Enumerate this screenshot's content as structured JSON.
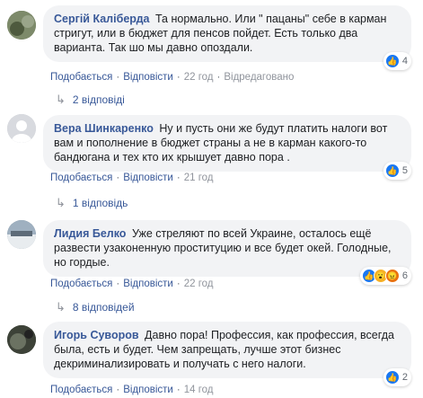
{
  "comments": [
    {
      "author": "Сергій Каліберда",
      "text": "Та нормально. Или \" пацаны\" себе в карман стригут, или в бюджет для пенсов пойдет. Есть только два варианта. Так шо мы давно опоздали.",
      "like_label": "Подобається",
      "reply_label": "Відповісти",
      "time": "22 год",
      "edited": "Відредаговано",
      "reaction_count": "4",
      "replies": "2 відповіді",
      "avatar_color": "#6d7a5a"
    },
    {
      "author": "Вера Шинкаренко",
      "text": "Ну и пусть они же будут платить налоги вот вам и пополнение в бюджет страны а не в карман какого-то бандюгана и тех кто их крышует давно пора .",
      "like_label": "Подобається",
      "reply_label": "Відповісти",
      "time": "21 год",
      "reaction_count": "5",
      "replies": "1 відповідь",
      "avatar_color": "#c8ccd1"
    },
    {
      "author": "Лидия Белко",
      "text": "Уже стреляют по всей Украине, осталось ещё развести узаконенную проституцию и все будет окей. Голодные, но гордые.",
      "like_label": "Подобається",
      "reply_label": "Відповісти",
      "time": "22 год",
      "reaction_count": "6",
      "replies": "8 відповідей",
      "avatar_color": "#8a9aa8"
    },
    {
      "author": "Игорь Суворов",
      "text": "Давно пора! Профессия, как профессия, всегда была, есть и будет. Чем запрещать, лучше этот бизнес декриминализировать и получать с него налоги.",
      "like_label": "Подобається",
      "reply_label": "Відповісти",
      "time": "14 год",
      "reaction_count": "2",
      "avatar_color": "#4a4f45"
    }
  ],
  "colors": {
    "link": "#385898",
    "bubble": "#f2f3f5",
    "like": "#1877f2"
  }
}
